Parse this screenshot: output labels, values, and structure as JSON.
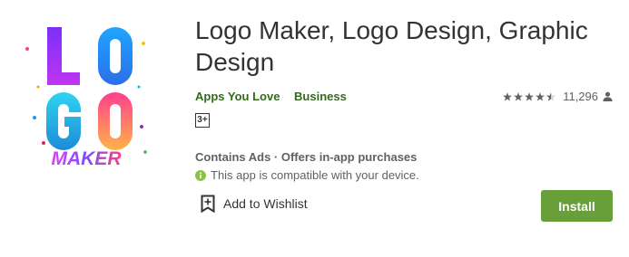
{
  "app": {
    "title": "Logo Maker, Logo Design, Graphic Design",
    "icon": "logo-maker-app-icon",
    "icon_letters": [
      "L",
      "O",
      "G",
      "O"
    ],
    "icon_word": "MAKER",
    "developer": "Apps You Love",
    "category": "Business",
    "content_rating": "3+",
    "rating_stars": 4.5,
    "rating_count": "11,296",
    "ads_text": "Contains Ads · Offers in-app purchases",
    "compatibility": "This app is compatible with your device.",
    "wishlist_label": "Add to Wishlist",
    "install_label": "Install"
  },
  "colors": {
    "accent_green": "#689f38",
    "meta_green": "#33691e",
    "icon_purple": "#9c27b0",
    "icon_blue": "#2196f3",
    "icon_pink": "#ff4081",
    "icon_orange": "#ff9800"
  }
}
